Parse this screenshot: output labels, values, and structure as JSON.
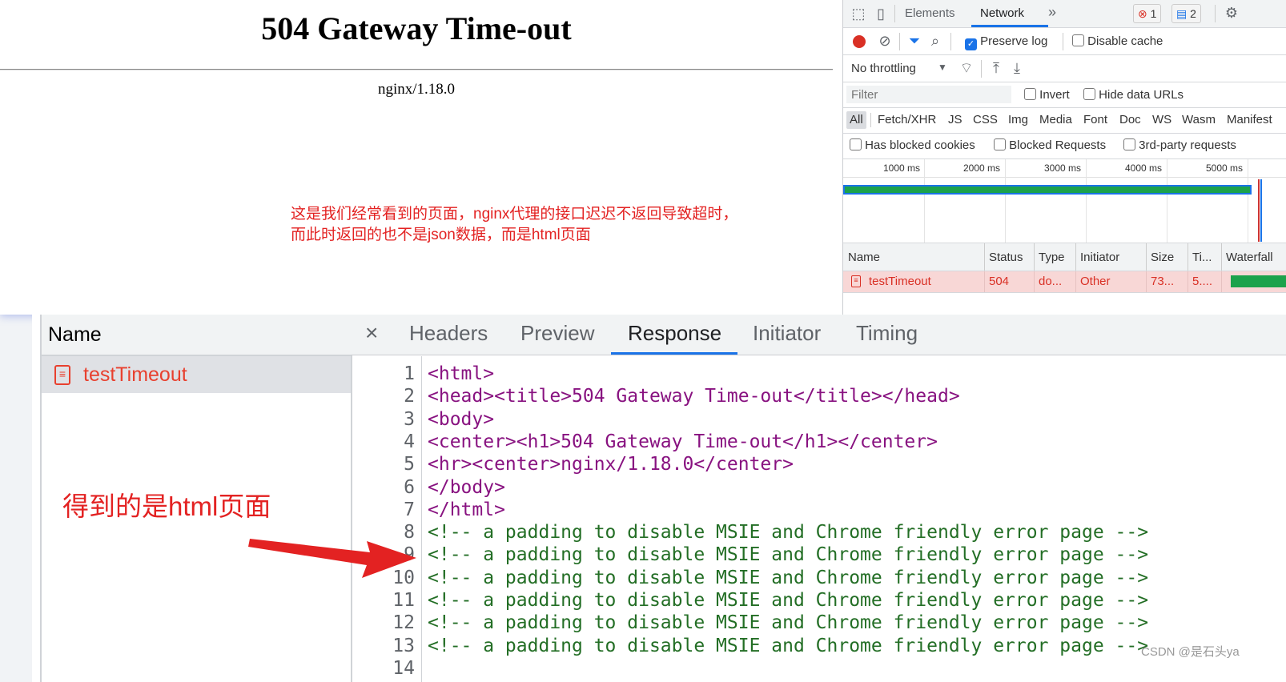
{
  "page": {
    "heading": "504 Gateway Time-out",
    "server": "nginx/1.18.0",
    "note_line1": "这是我们经常看到的页面，nginx代理的接口迟迟不返回导致超时，",
    "note_line2": "而此时返回的也不是json数据，而是html页面"
  },
  "devtools": {
    "tabs": [
      "Elements",
      "Network"
    ],
    "more": "»",
    "error_count": "1",
    "message_count": "2",
    "preserve_log": "Preserve log",
    "disable_cache": "Disable cache",
    "throttling": "No throttling",
    "filter_placeholder": "Filter",
    "invert": "Invert",
    "hide_data_urls": "Hide data URLs",
    "types": [
      "All",
      "Fetch/XHR",
      "JS",
      "CSS",
      "Img",
      "Media",
      "Font",
      "Doc",
      "WS",
      "Wasm",
      "Manifest"
    ],
    "has_blocked_cookies": "Has blocked cookies",
    "blocked_requests": "Blocked Requests",
    "third_party": "3rd-party requests",
    "timeline_ticks": [
      "1000 ms",
      "2000 ms",
      "3000 ms",
      "4000 ms",
      "5000 ms"
    ],
    "columns": [
      "Name",
      "Status",
      "Type",
      "Initiator",
      "Size",
      "Ti...",
      "Waterfall"
    ],
    "request": {
      "name": "testTimeout",
      "status": "504",
      "type": "do...",
      "initiator": "Other",
      "size": "73...",
      "time": "5...."
    }
  },
  "detail": {
    "name_header": "Name",
    "item": "testTimeout",
    "close": "×",
    "tabs": [
      "Headers",
      "Preview",
      "Response",
      "Initiator",
      "Timing"
    ],
    "active_tab": "Response",
    "line_numbers": [
      "1",
      "2",
      "3",
      "4",
      "5",
      "6",
      "7",
      "8",
      "9",
      "10",
      "11",
      "12",
      "13",
      "14"
    ],
    "code": {
      "l1": "<html>",
      "l2": "<head><title>504 Gateway Time-out</title></head>",
      "l3": "<body>",
      "l4": "<center><h1>504 Gateway Time-out</h1></center>",
      "l5": "<hr><center>nginx/1.18.0</center>",
      "l6": "</body>",
      "l7": "</html>",
      "comment": "<!-- a padding to disable MSIE and Chrome friendly error page -->"
    }
  },
  "annotation": "得到的是html页面",
  "watermark": "CSDN @是石头ya",
  "colors": {
    "accent": "#1a73e8",
    "error_red": "#e32222",
    "row_highlight": "#f8d7d6",
    "waterfall_green": "#1ca24b"
  }
}
